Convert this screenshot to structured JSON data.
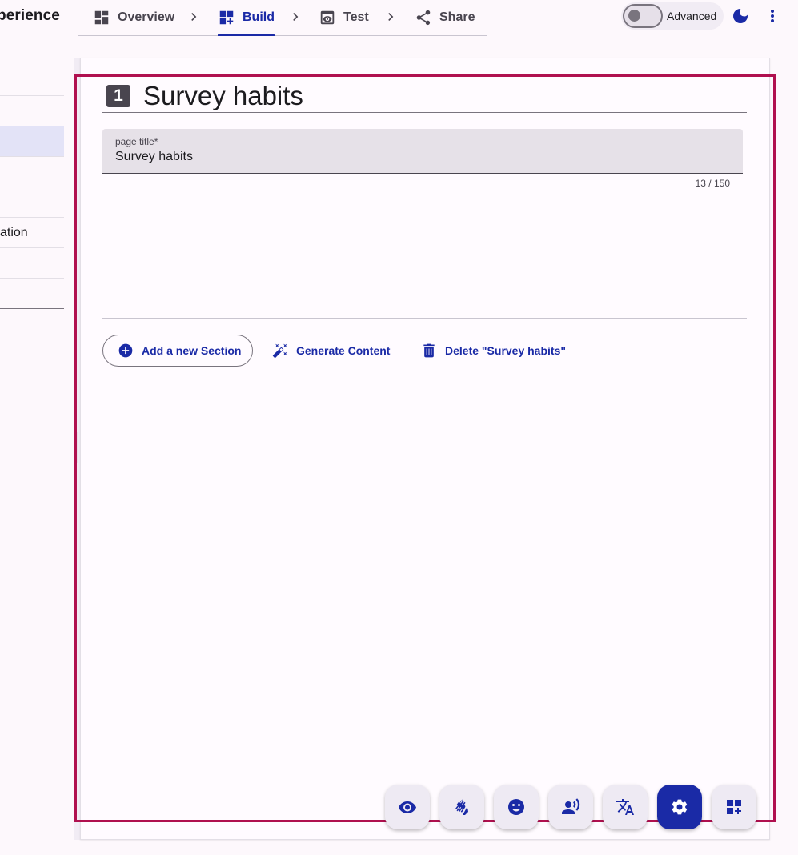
{
  "header": {
    "app_title": "perience",
    "steps": [
      {
        "label": "Overview",
        "icon": "dashboard-icon",
        "active": false
      },
      {
        "label": "Build",
        "icon": "dashboard-add-icon",
        "active": true
      },
      {
        "label": "Test",
        "icon": "preview-eye-icon",
        "active": false
      },
      {
        "label": "Share",
        "icon": "share-icon",
        "active": false
      }
    ],
    "advanced_toggle": {
      "label": "Advanced",
      "on": false
    },
    "theme_icon": "dark-mode-moon-icon",
    "menu_icon": "more-vert-icon"
  },
  "left_list": {
    "items": [
      {
        "label": ""
      },
      {
        "label": ""
      },
      {
        "label": "",
        "selected": true
      },
      {
        "label": ""
      },
      {
        "label": ""
      },
      {
        "label": "ation"
      },
      {
        "label": ""
      },
      {
        "label": ""
      }
    ]
  },
  "page": {
    "number": "1",
    "title": "Survey habits",
    "title_field": {
      "label": "page title*",
      "value": "Survey habits",
      "counter": "13 / 150"
    },
    "actions": {
      "add_section": "Add a new Section",
      "generate_content": "Generate Content",
      "delete": "Delete \"Survey habits\""
    }
  },
  "fabs": [
    {
      "icon": "visibility-eye-icon"
    },
    {
      "icon": "sign-language-icon"
    },
    {
      "icon": "emoji-smile-icon"
    },
    {
      "icon": "record-voice-icon"
    },
    {
      "icon": "translate-icon"
    },
    {
      "icon": "settings-gear-icon",
      "active": true
    },
    {
      "icon": "dashboard-add-icon"
    }
  ],
  "colors": {
    "accent": "#1a2aa6",
    "focus_frame": "#b0104f",
    "background": "#fdf8fc"
  }
}
